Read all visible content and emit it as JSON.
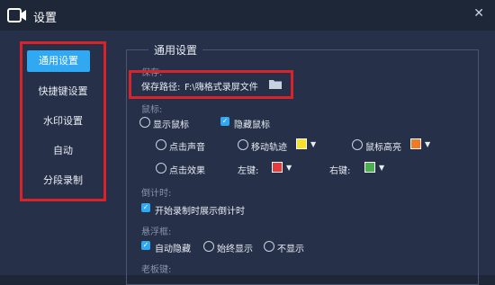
{
  "window": {
    "title": "设置",
    "close_glyph": "✕"
  },
  "sidebar": {
    "items": [
      {
        "label": "通用设置",
        "active": true
      },
      {
        "label": "快捷键设置",
        "active": false
      },
      {
        "label": "水印设置",
        "active": false
      },
      {
        "label": "自动",
        "active": false
      },
      {
        "label": "分段录制",
        "active": false
      }
    ]
  },
  "panel": {
    "title": "通用设置",
    "save_section": "保存:",
    "save_label": "保存路径:",
    "save_path": "F:\\嗨格式录屏文件",
    "mouse_section": "鼠标:",
    "show_mouse": "显示鼠标",
    "hide_mouse": "隐藏鼠标",
    "click_sound": "点击声音",
    "move_track": "移动轨迹",
    "mouse_highlight": "鼠标高亮",
    "click_effect": "点击效果",
    "left_key": "左键:",
    "right_key": "右键:",
    "countdown_section": "倒计时:",
    "countdown_option": "开始录制时展示倒计时",
    "float_section": "悬浮框:",
    "auto_hide": "自动隐藏",
    "always_show": "始终显示",
    "no_show": "不显示",
    "boss_section": "老板键:"
  },
  "colors": {
    "move_track": "#f7e12b",
    "mouse_highlight": "#f07a22",
    "left_key": "#e63b3b",
    "right_key": "#4caf50",
    "accent": "#30a8f2",
    "annotation": "#d9232a"
  }
}
